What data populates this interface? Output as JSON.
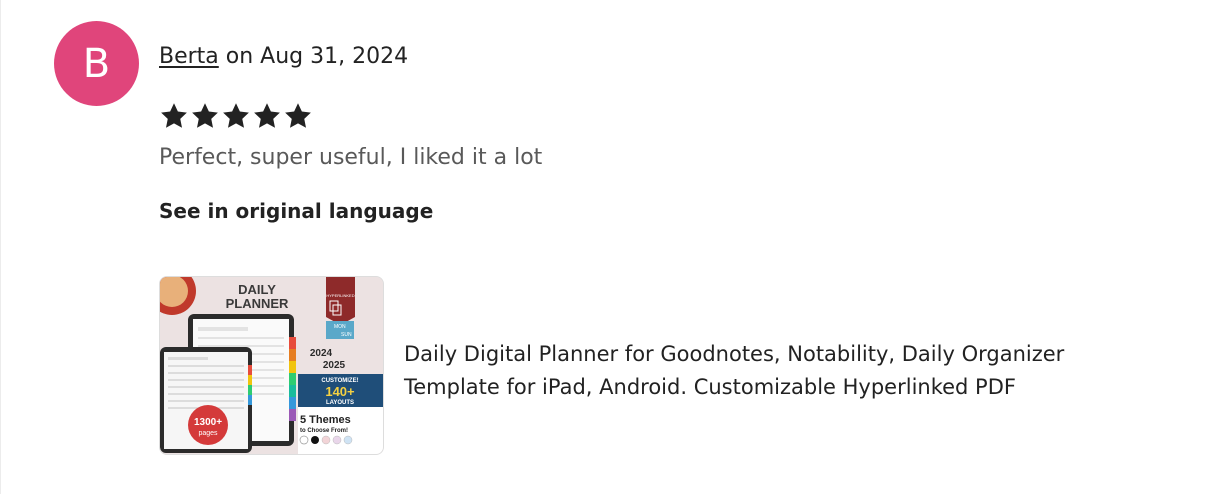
{
  "review": {
    "avatar_initial": "B",
    "avatar_color": "#e0457b",
    "author": "Berta",
    "date_text": "on Aug 31, 2024",
    "rating": 5,
    "rating_max": 5,
    "text": "Perfect, super useful, I liked it a lot",
    "translate_label": "See in original language"
  },
  "item": {
    "title": "Daily Digital Planner for Goodnotes, Notability, Daily Organizer Template for iPad, Android. Customizable Hyperlinked PDF",
    "thumbnail": {
      "heading_line1": "DAILY",
      "heading_line2": "PLANNER",
      "years_line1": "2024",
      "years_line2": "2025",
      "customize": "CUSTOMIZE!",
      "layouts_count": "140+",
      "layouts_label": "LAYOUTS",
      "themes_line1": "5 Themes",
      "themes_line2": "to Choose From!",
      "pages_count": "1300+",
      "pages_label": "pages",
      "ribbon_text": "HYPERLINKED",
      "tag_mon": "MON",
      "tag_sun": "SUN"
    }
  },
  "colors": {
    "star": "#222222",
    "text_primary": "#222222",
    "text_secondary": "#595959"
  }
}
